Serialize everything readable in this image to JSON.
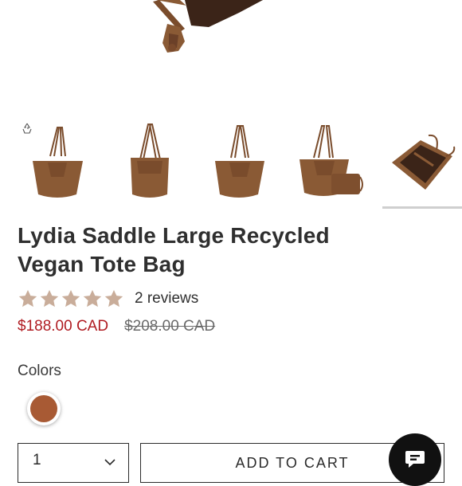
{
  "product": {
    "title_line1": "Lydia Saddle Large Recycled",
    "title_line2": "Vegan Tote Bag",
    "rating": 5,
    "rating_max": 5,
    "reviews_text": "2 reviews",
    "sale_price": "$188.00 CAD",
    "compare_price": "$208.00 CAD"
  },
  "gallery": {
    "thumbnail_count": 5,
    "selected_index": 4
  },
  "colors": {
    "label": "Colors",
    "selected_swatch_color": "#a85a34"
  },
  "purchase": {
    "quantity": "1",
    "add_to_cart_label": "ADD TO CART"
  },
  "theme": {
    "sale_color": "#b01c22",
    "star_color": "#c9ad9a",
    "bag_color": "#8a5a35"
  },
  "icons": {
    "recycle": "recycle-icon",
    "stars": "star-icon",
    "qty_chevron": "chevron-down-icon",
    "chat": "chat-icon"
  }
}
